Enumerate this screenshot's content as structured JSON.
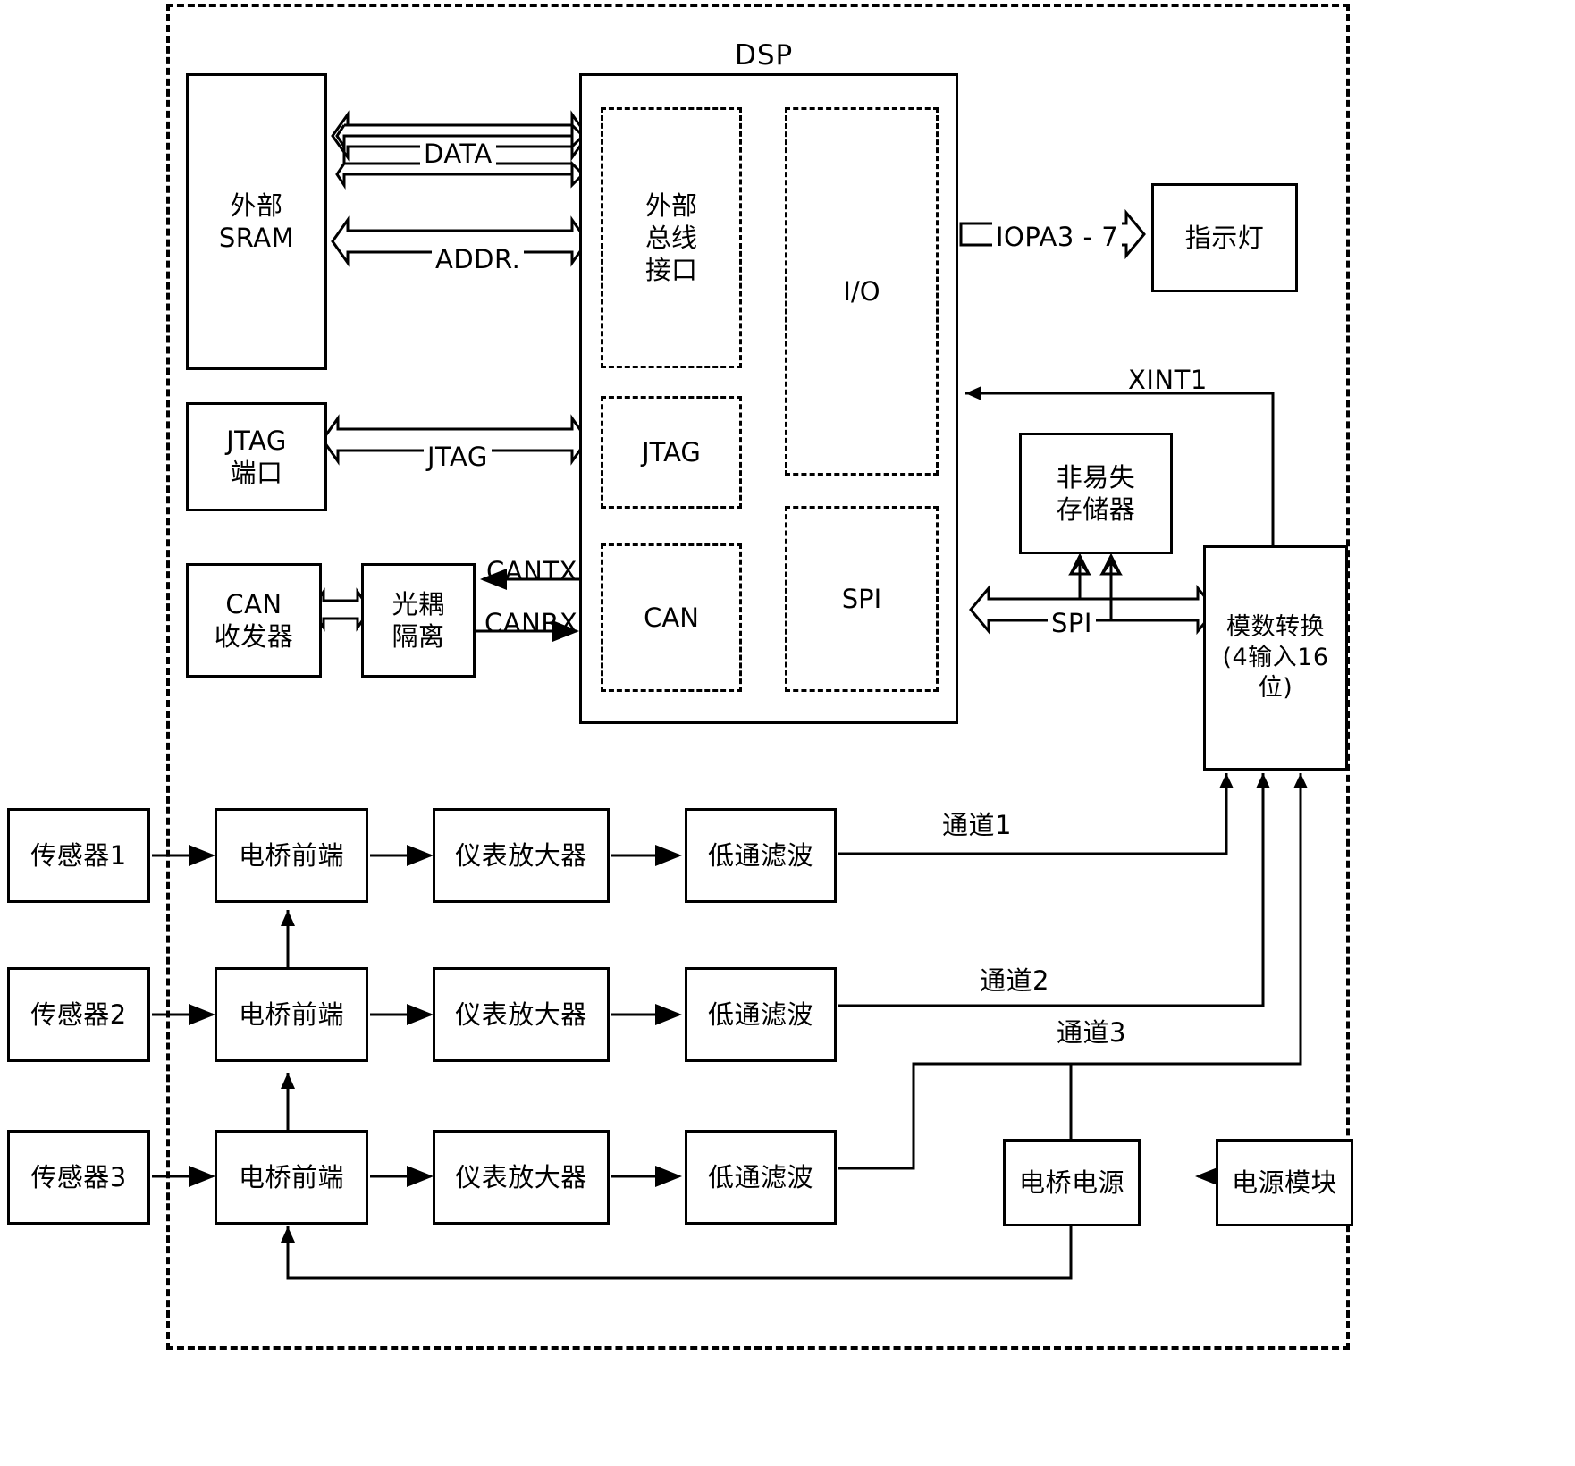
{
  "diagram": {
    "title_dsp": "DSP",
    "boundary": "system-boundary-dashed"
  },
  "blocks": {
    "external_sram": "外部\nSRAM",
    "external_sram_line1": "外部",
    "external_sram_line2": "SRAM",
    "jtag_port_line1": "JTAG",
    "jtag_port_line2": "端口",
    "can_transceiver_line1": "CAN",
    "can_transceiver_line2": "收发器",
    "opto_isolation_line1": "光耦",
    "opto_isolation_line2": "隔离",
    "dsp_ext_bus_if": "外部\n总线\n接口",
    "dsp_ext_bus_if_l1": "外部",
    "dsp_ext_bus_if_l2": "总线",
    "dsp_ext_bus_if_l3": "接口",
    "dsp_jtag": "JTAG",
    "dsp_can": "CAN",
    "dsp_io": "I/O",
    "dsp_spi": "SPI",
    "indicator_lamp": "指示灯",
    "nonvolatile_memory_l1": "非易失",
    "nonvolatile_memory_l2": "存储器",
    "adc_l1": "模数转换",
    "adc_l2": "(4输入16",
    "adc_l3": "位)",
    "sensor1": "传感器1",
    "sensor2": "传感器2",
    "sensor3": "传感器3",
    "bridge_frontend": "电桥前端",
    "instr_amp": "仪表放大器",
    "lowpass_filter": "低通滤波",
    "bridge_power": "电桥电源",
    "power_module": "电源模块"
  },
  "signal_labels": {
    "data": "DATA",
    "addr": "ADDR.",
    "jtag": "JTAG",
    "cantx": "CANTX",
    "canrx": "CANRX",
    "iopa": "IOPA3 - 7",
    "xint1": "XINT1",
    "spi": "SPI",
    "channel1": "通道1",
    "channel2": "通道2",
    "channel3": "通道3"
  },
  "colors": {
    "stroke": "#000000",
    "background": "#ffffff"
  }
}
